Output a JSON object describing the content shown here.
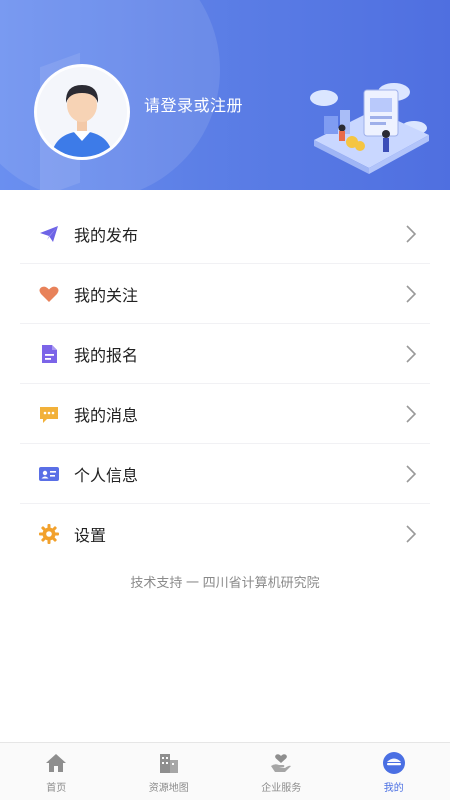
{
  "header": {
    "login_prompt": "请登录或注册"
  },
  "menu": {
    "items": [
      {
        "label": "我的发布",
        "icon": "paper-plane-icon"
      },
      {
        "label": "我的关注",
        "icon": "heart-icon"
      },
      {
        "label": "我的报名",
        "icon": "document-icon"
      },
      {
        "label": "我的消息",
        "icon": "message-icon"
      },
      {
        "label": "个人信息",
        "icon": "id-card-icon"
      },
      {
        "label": "设置",
        "icon": "gear-icon"
      }
    ]
  },
  "footer": {
    "support_text": "技术支持 一 四川省计算机研究院"
  },
  "tabbar": {
    "tabs": [
      {
        "label": "首页",
        "icon": "home-icon",
        "active": false
      },
      {
        "label": "资源地图",
        "icon": "building-icon",
        "active": false
      },
      {
        "label": "企业服务",
        "icon": "hand-heart-icon",
        "active": false
      },
      {
        "label": "我的",
        "icon": "profile-icon",
        "active": true
      }
    ]
  },
  "colors": {
    "header_start": "#6a8ff0",
    "header_end": "#4f6fe0",
    "accent": "#4a6fe3",
    "plane": "#6d63e6",
    "heart": "#e8825a",
    "document": "#7b64e8",
    "message": "#f2b13a",
    "id_card": "#5a6fe6",
    "gear": "#f2a12c"
  }
}
